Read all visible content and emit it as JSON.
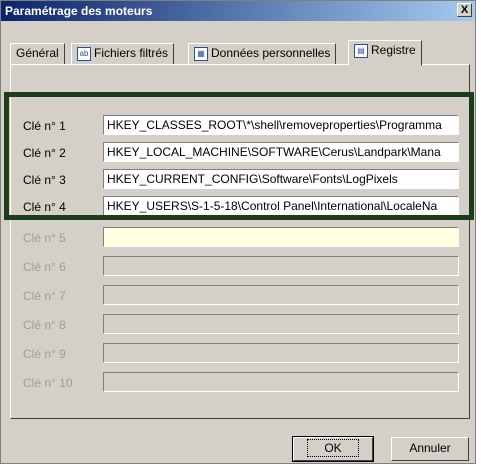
{
  "window": {
    "title": "Paramétrage des moteurs",
    "close_label": "X"
  },
  "tabs": [
    {
      "label": "Général",
      "icon": "none"
    },
    {
      "label": "Fichiers filtrés",
      "icon": "ab-icon"
    },
    {
      "label": "Données personnelles",
      "icon": "user-data-icon"
    },
    {
      "label": "Registre",
      "icon": "registry-icon"
    }
  ],
  "keys": [
    {
      "label": "Clé n° 1",
      "value": "HKEY_CLASSES_ROOT\\*\\shell\\removeproperties\\Programma",
      "state": "enabled"
    },
    {
      "label": "Clé n° 2",
      "value": "HKEY_LOCAL_MACHINE\\SOFTWARE\\Cerus\\Landpark\\Mana",
      "state": "enabled"
    },
    {
      "label": "Clé n° 3",
      "value": "HKEY_CURRENT_CONFIG\\Software\\Fonts\\LogPixels",
      "state": "enabled"
    },
    {
      "label": "Clé n° 4",
      "value": "HKEY_USERS\\S-1-5-18\\Control Panel\\International\\LocaleNa",
      "state": "enabled"
    },
    {
      "label": "Clé n° 5",
      "value": "",
      "state": "active-empty"
    },
    {
      "label": "Clé n° 6",
      "value": "",
      "state": "disabled"
    },
    {
      "label": "Clé n° 7",
      "value": "",
      "state": "disabled"
    },
    {
      "label": "Clé n° 8",
      "value": "",
      "state": "disabled"
    },
    {
      "label": "Clé n° 9",
      "value": "",
      "state": "disabled"
    },
    {
      "label": "Clé n° 10",
      "value": "",
      "state": "disabled"
    }
  ],
  "buttons": {
    "ok": "OK",
    "cancel": "Annuler"
  },
  "colors": {
    "title_gradient_start": "#0a246a",
    "title_gradient_end": "#a6caf0",
    "highlight_frame": "#1b3d1b",
    "active_field": "#ffffe1"
  }
}
